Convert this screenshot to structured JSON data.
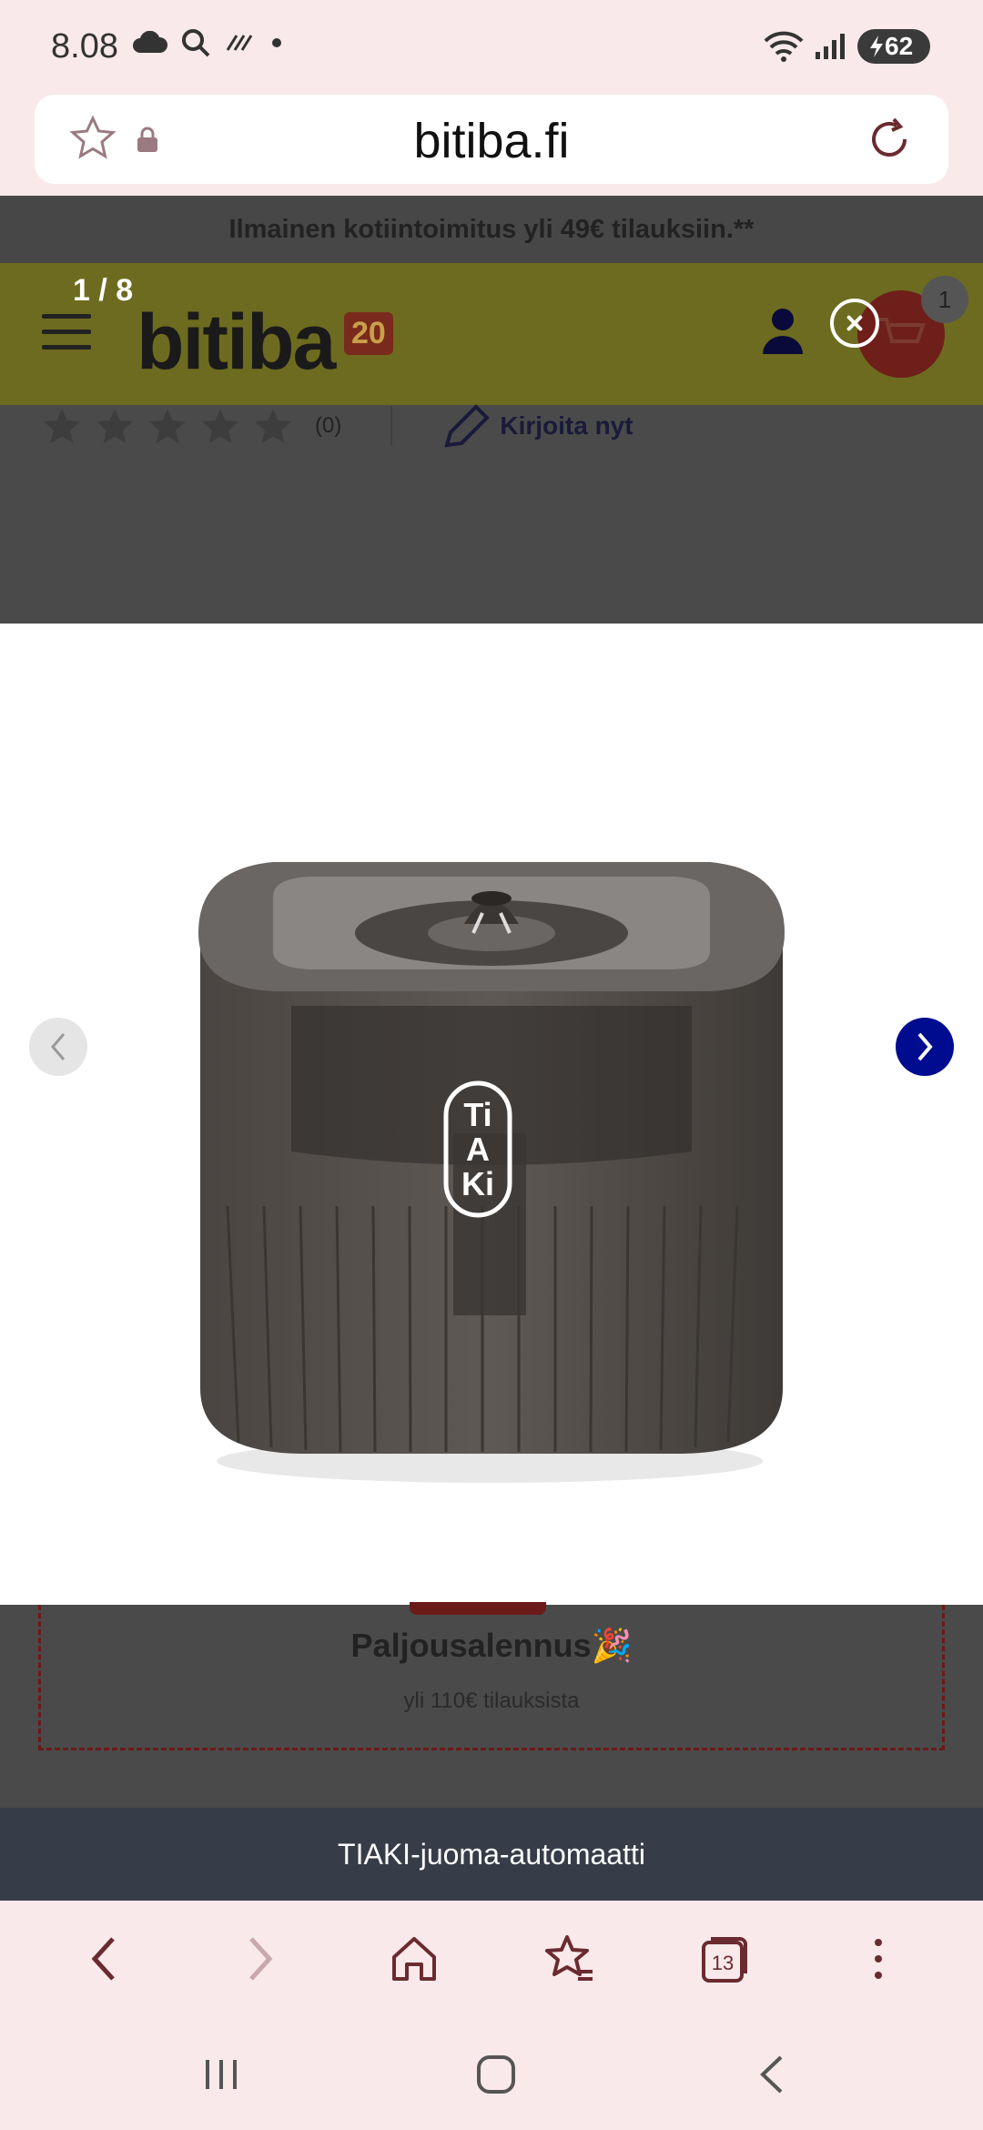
{
  "status_bar": {
    "time": "8.08",
    "battery": "62"
  },
  "browser": {
    "url": "bitiba.fi",
    "tabs_count": "13"
  },
  "site": {
    "promo_text": "Ilmainen kotiintoimitus yli 49€ tilauksiin.**",
    "logo_text": "bitiba",
    "logo_badge": "20",
    "cart_count": "1",
    "rating_count": "(0)",
    "write_review": "Kirjoita nyt",
    "discount_title": "Paljousalennus🎉",
    "discount_subtitle": "yli 110€ tilauksista"
  },
  "lightbox": {
    "counter": "1 / 8",
    "caption": "TIAKI-juoma-automaatti",
    "product_brand": "TiAKi"
  },
  "colors": {
    "browser_bg": "#f9e9ea",
    "accent_blue": "#000c8f",
    "overlay_dark": "#4a4a4a",
    "caption_bg": "#363d48"
  }
}
